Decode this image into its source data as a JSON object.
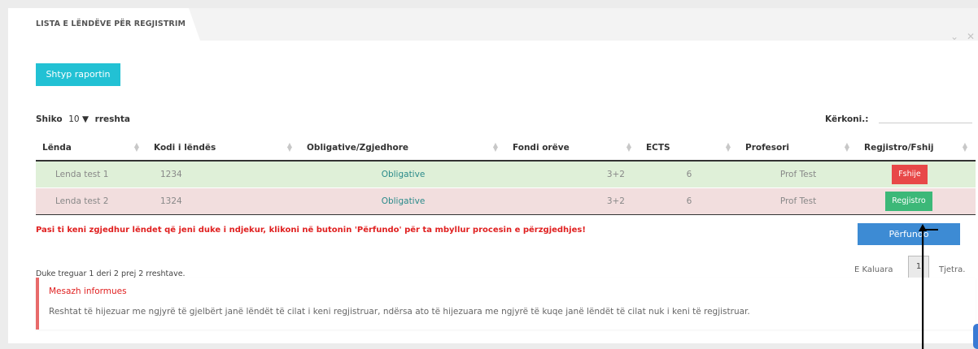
{
  "tab": {
    "title": "LISTA E LËNDËVE PËR REGJISTRIM"
  },
  "window_icons": {
    "collapse": "⌄",
    "close": "✕"
  },
  "toolbar": {
    "print_label": "Shtyp raportin"
  },
  "length": {
    "prefix": "Shiko",
    "value": "10",
    "arrow": "▼",
    "suffix": "rreshta"
  },
  "search": {
    "label": "Kërkoni.:",
    "value": ""
  },
  "table": {
    "headers": [
      "Lënda",
      "Kodi i lëndës",
      "Obligative/Zgjedhore",
      "Fondi orëve",
      "ECTS",
      "Profesori",
      "Regjistro/Fshij"
    ],
    "rows": [
      {
        "lenda": "Lenda test 1",
        "kodi": "1234",
        "tipi": "Obligative",
        "fondi": "3+2",
        "ects": "6",
        "profesori": "Prof Test",
        "action": "Fshije",
        "status": "registered"
      },
      {
        "lenda": "Lenda test 2",
        "kodi": "1324",
        "tipi": "Obligative",
        "fondi": "3+2",
        "ects": "6",
        "profesori": "Prof Test",
        "action": "Regjistro",
        "status": "not-registered"
      }
    ]
  },
  "warning": "Pasi ti keni zgjedhur lëndet që jeni duke i ndjekur, klikoni në butonin 'Përfundo' për ta mbyllur procesin e përzgjedhjes!",
  "finish_label": "Përfundo",
  "info_count": "Duke treguar 1 deri 2 prej 2 rreshtave.",
  "pagination": {
    "prev": "E Kaluara",
    "current": "1",
    "next": "Tjetra."
  },
  "message": {
    "title": "Mesazh informues",
    "text": "Reshtat të hijezuar me ngjyrë të gjelbërt janë lëndët të cilat i keni regjistruar, ndërsa ato të hijezuara me ngjyrë të kuqe janë lëndët të cilat nuk i keni të regjistruar."
  },
  "colors": {
    "print_button": "#22c1d4",
    "registered_row": "#dff0d8",
    "unregistered_row": "#f2dede",
    "delete_button": "#e84848",
    "register_button": "#3cb878",
    "finish_button": "#3d8bd4",
    "warning_text": "#e02020"
  }
}
